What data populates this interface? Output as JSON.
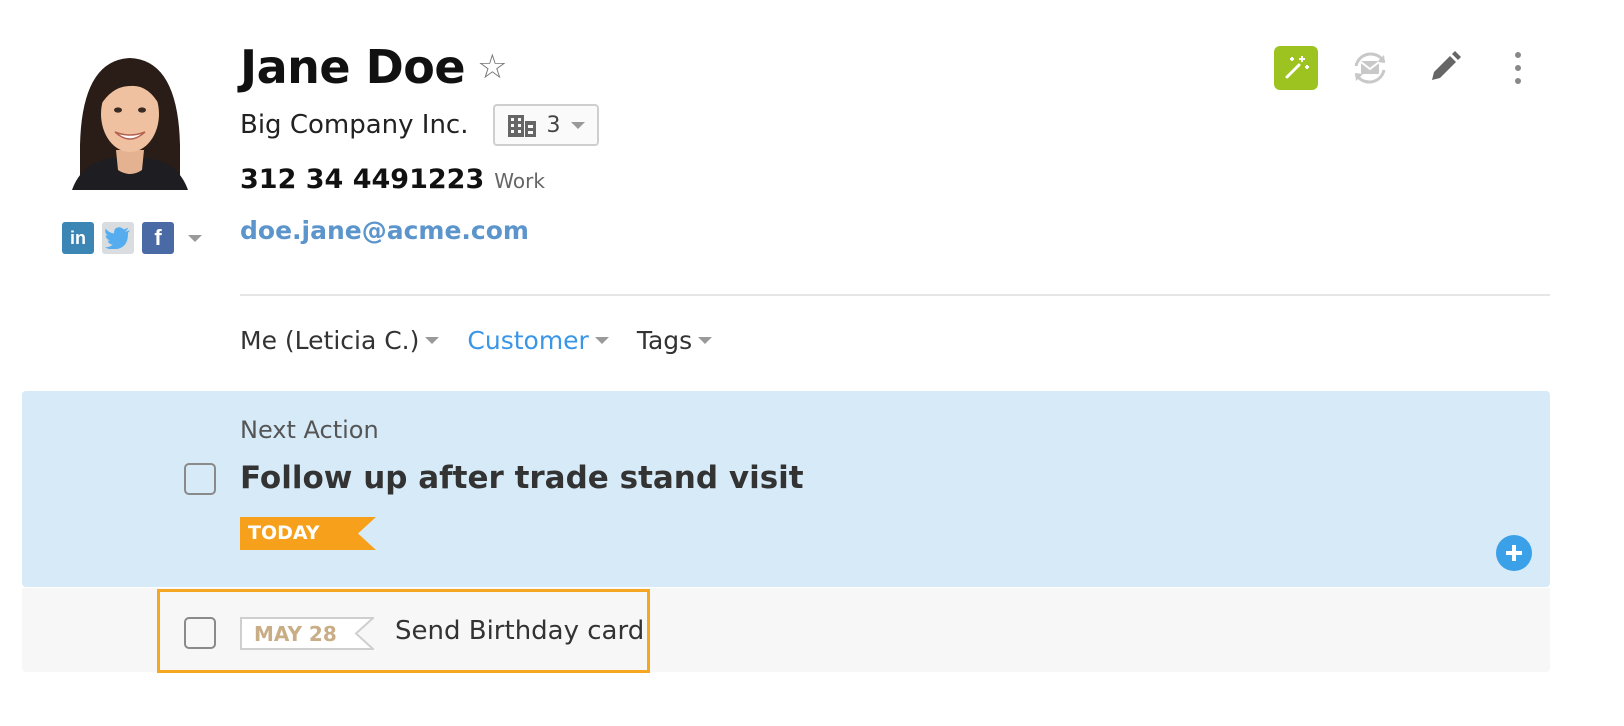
{
  "contact": {
    "name": "Jane Doe",
    "company": "Big Company Inc.",
    "company_count": "3",
    "phone": "312 34 4491223",
    "phone_type": "Work",
    "email": "doe.jane@acme.com"
  },
  "social": {
    "linkedin_label": "in",
    "facebook_label": "f",
    "icons": [
      "linkedin-icon",
      "twitter-icon",
      "facebook-icon"
    ]
  },
  "meta": {
    "owner": "Me (Leticia C.)",
    "status": "Customer",
    "tags": "Tags"
  },
  "next_action": {
    "section_label": "Next Action",
    "title": "Follow up after trade stand visit",
    "due": "TODAY"
  },
  "other_tasks": [
    {
      "date": "MAY 28",
      "title": "Send Birthday card"
    }
  ],
  "colors": {
    "accent_blue": "#3a96e6",
    "link_blue": "#5b95cc",
    "next_action_bg": "#d6eaf8",
    "today_orange": "#f7a01c",
    "highlight_border": "#f5a623",
    "magic_green": "#9cc320"
  }
}
